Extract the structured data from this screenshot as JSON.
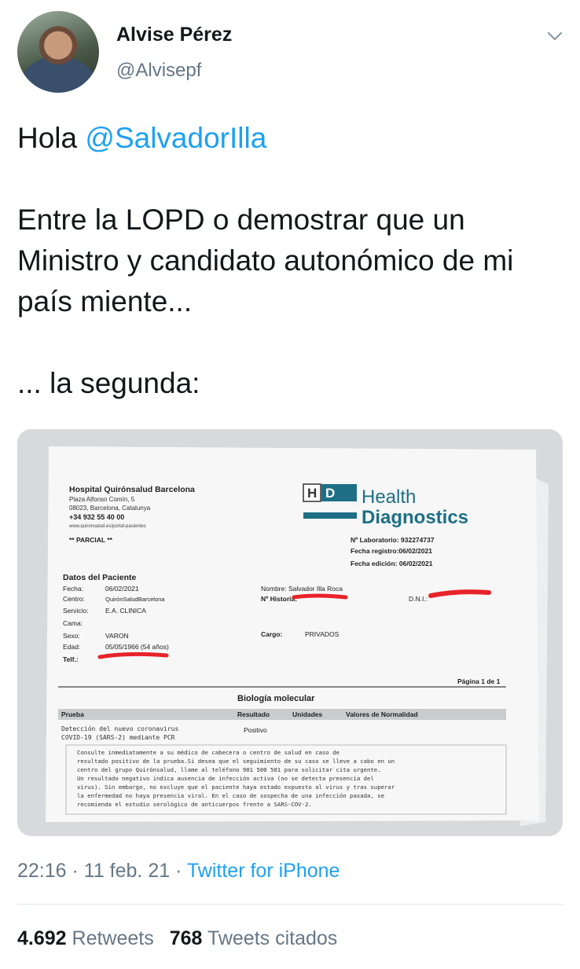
{
  "author": {
    "name": "Alvise Pérez",
    "handle": "@Alvisepf",
    "avatar_icon": "profile-photo"
  },
  "tweet": {
    "greeting": "Hola ",
    "mention": "@SalvadorIlla",
    "paragraph2": "Entre la LOPD o demostrar que un Ministro y candidato autonómico de mi país miente...",
    "paragraph3": "... la segunda:"
  },
  "meta": {
    "time": "22:16",
    "separator": " · ",
    "date": "11 feb. 21",
    "source": "Twitter for iPhone"
  },
  "stats": {
    "retweets_count": "4.692",
    "retweets_label": "Retweets",
    "quotes_count": "768",
    "quotes_label": "Tweets citados"
  },
  "document": {
    "hospital_name": "Hospital Quirónsalud Barcelona",
    "address1": "Plaza Alfonso Comín, 5",
    "address2": "08023, Barcelona, Catalunya",
    "phone": "+34 932 55 40 00",
    "web": "www.quironsalud.es/portal-pacientes",
    "partial": "** PARCIAL **",
    "brand_logo": "HD",
    "brand_line1": "Health",
    "brand_line2": "Diagnostics",
    "lab_no": "Nº Laboratorio: 932274737",
    "reg_date": "Fecha registro:06/02/2021",
    "edit_date": "Fecha edición: 06/02/2021",
    "patient_heading": "Datos del Paciente",
    "fields": [
      {
        "label": "Fecha:",
        "value": "06/02/2021"
      },
      {
        "label": "Centro:",
        "value": "QuirónSaludBarcelona"
      },
      {
        "label": "Servicio:",
        "value": "E.A. CLINICA"
      },
      {
        "label": "Cama:",
        "value": ""
      },
      {
        "label": "Sexo:",
        "value": "VARON"
      },
      {
        "label": "Edad:",
        "value": "05/05/1966 (54 años)"
      },
      {
        "label": "Telf.:",
        "value": ""
      }
    ],
    "name_label": "Nombre: Salvador Illa Roca",
    "history_label": "Nº Historia:",
    "dni_label": "D.N.I.:",
    "cargo_label": "Cargo:",
    "cargo_value": "PRIVADOS",
    "page": "Página 1 de 1",
    "section": "Biología molecular",
    "table_headers": [
      "Prueba",
      "Resultado",
      "Unidades",
      "Valores de Normalidad"
    ],
    "test_line1": "Detección del nuevo coronavirus",
    "test_line2": "COVID-19 (SARS-2) mediante PCR",
    "test_result": "Positivo",
    "notes": [
      "Consulte inmediatamente a su médico de cabecera o centro de salud en caso de",
      "resultado positivo de la prueba.Si desea que el seguimiento de su caso se lleve a cabo en un",
      "centro del grupo Quirónsalud, llame al teléfono 901 500 501 para solicitar cita urgente.",
      "Un resultado negativo indica ausencia de infección activa (no se detecta presencia del",
      "virus). Sin embargo, no excluye que el paciente haya estado expuesto al virus y tras superar",
      "la enfermedad no haya presencia viral. En el caso de sospecha de una infección pasada, se",
      "recomienda el estudio serológico de anticuerpos frente a SARS-COV-2."
    ]
  },
  "colors": {
    "accent": "#1da1f2",
    "muted": "#657786",
    "text": "#14171a",
    "brand_teal": "#1e6f86",
    "redaction": "#e8232a"
  }
}
